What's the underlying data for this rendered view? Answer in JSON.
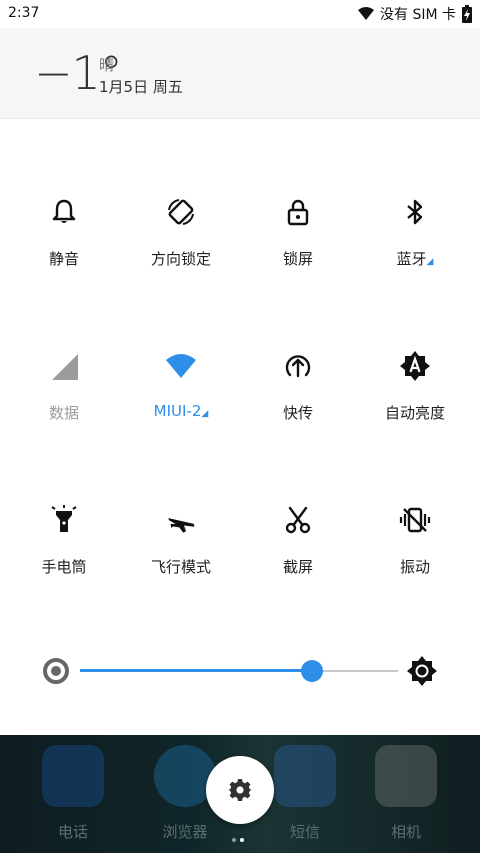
{
  "status_bar": {
    "time": "2:37",
    "carrier": "没有 SIM 卡"
  },
  "weather": {
    "temperature": "−1°",
    "condition": "晴",
    "date": "1月5日 周五"
  },
  "tiles": [
    {
      "label": "静音",
      "icon": "bell-icon",
      "state": "normal"
    },
    {
      "label": "方向锁定",
      "icon": "rotate-lock-icon",
      "state": "normal"
    },
    {
      "label": "锁屏",
      "icon": "lock-icon",
      "state": "normal"
    },
    {
      "label": "蓝牙",
      "icon": "bluetooth-icon",
      "state": "normal",
      "expandable": true
    },
    {
      "label": "数据",
      "icon": "cellular-data-icon",
      "state": "disabled"
    },
    {
      "label": "MIUI-2",
      "icon": "wifi-icon",
      "state": "active",
      "expandable": true
    },
    {
      "label": "快传",
      "icon": "quick-transfer-icon",
      "state": "normal"
    },
    {
      "label": "自动亮度",
      "icon": "auto-brightness-icon",
      "state": "normal"
    },
    {
      "label": "手电筒",
      "icon": "flashlight-icon",
      "state": "normal"
    },
    {
      "label": "飞行模式",
      "icon": "airplane-icon",
      "state": "normal"
    },
    {
      "label": "截屏",
      "icon": "scissors-icon",
      "state": "normal"
    },
    {
      "label": "振动",
      "icon": "vibrate-icon",
      "state": "normal"
    }
  ],
  "brightness": {
    "level_fraction": 0.73
  },
  "dock_apps": [
    {
      "label": "电话",
      "icon": "phone-app-icon"
    },
    {
      "label": "浏览器",
      "icon": "browser-app-icon"
    },
    {
      "label": "短信",
      "icon": "sms-app-icon"
    },
    {
      "label": "相机",
      "icon": "camera-app-icon"
    }
  ],
  "colors": {
    "accent": "#2f8ee8",
    "inactive": "#9c9c9c"
  }
}
